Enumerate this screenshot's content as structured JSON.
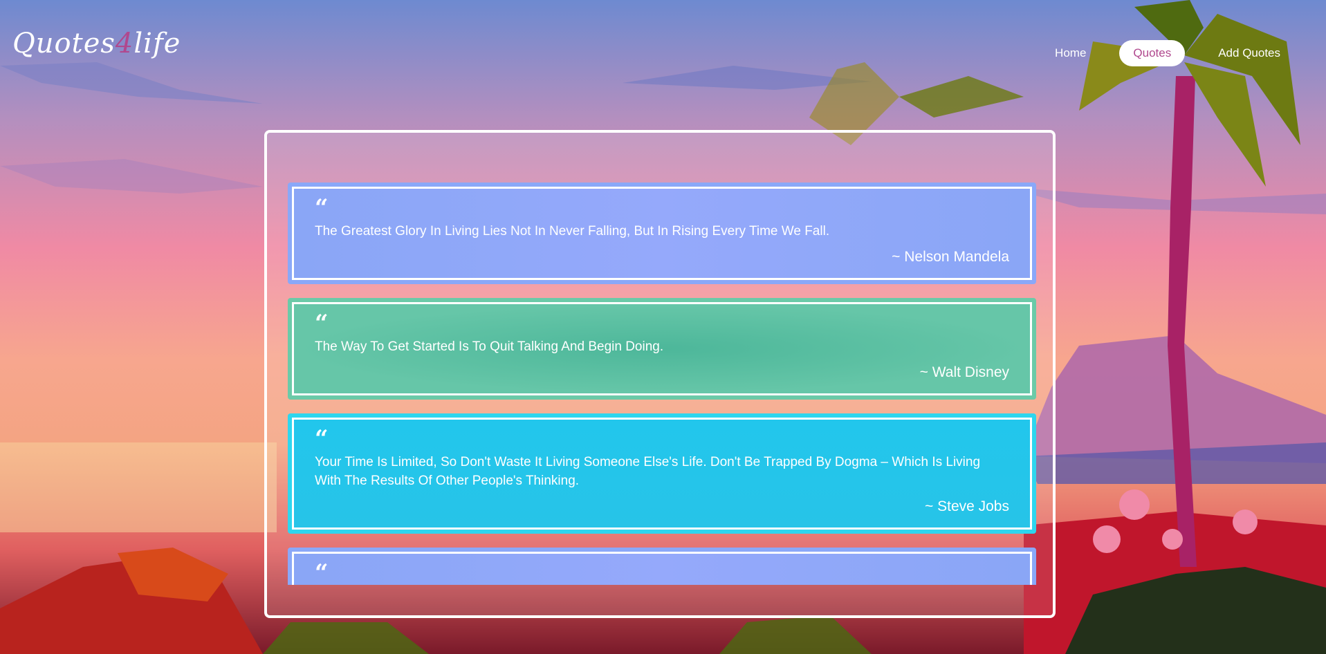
{
  "logo": {
    "prefix": "Quotes",
    "accent": "4",
    "suffix": "life"
  },
  "nav": [
    {
      "label": "Home",
      "active": false
    },
    {
      "label": "Quotes",
      "active": true
    },
    {
      "label": "Add Quotes",
      "active": false
    }
  ],
  "quotes": [
    {
      "mark": "“",
      "text": "The Greatest Glory In Living Lies Not In Never Falling, But In Rising Every Time We Fall.",
      "author": "~ Nelson Mandela",
      "color": "#8aa8f8"
    },
    {
      "mark": "“",
      "text": "The Way To Get Started Is To Quit Talking And Begin Doing.",
      "author": "~ Walt Disney",
      "color": "#6bcaa8"
    },
    {
      "mark": "“",
      "text": "Your Time Is Limited, So Don't Waste It Living Someone Else's Life. Don't Be Trapped By Dogma – Which Is Living With The Results Of Other People's Thinking.",
      "author": "~ Steve Jobs",
      "color": "#2ed6ee"
    },
    {
      "mark": "“",
      "text": "",
      "author": "",
      "color": "#8aa8f8"
    }
  ],
  "colors": {
    "accent": "#b0488e",
    "panel_border": "#ffffff"
  }
}
